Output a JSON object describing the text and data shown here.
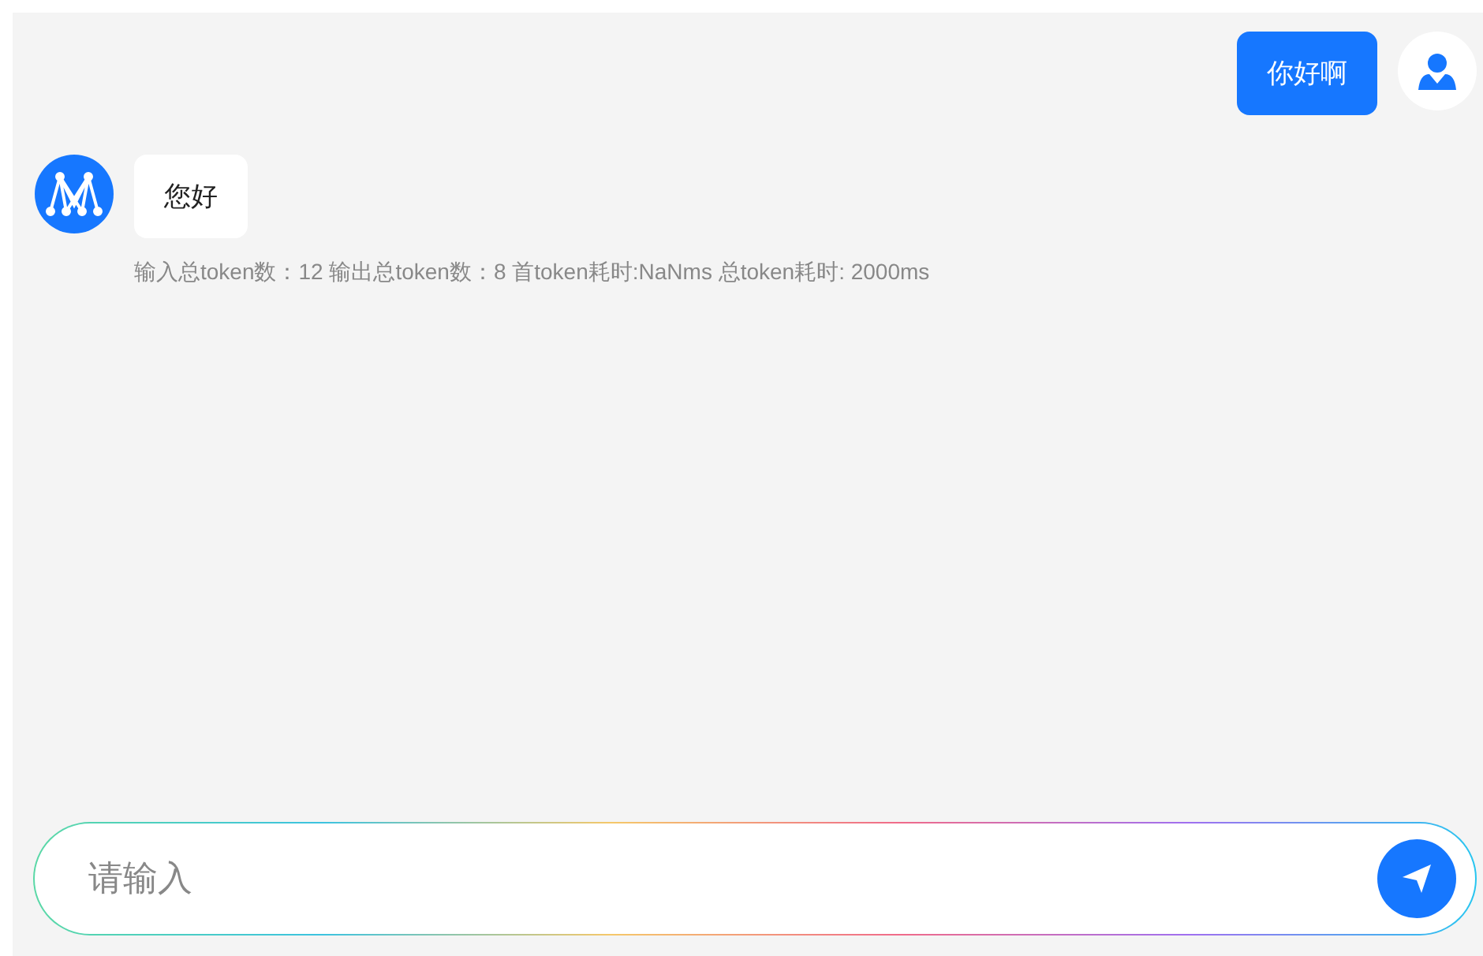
{
  "messages": [
    {
      "kind": "user",
      "text": "你好啊"
    },
    {
      "kind": "bot",
      "text": "您好",
      "stats": "输入总token数：12 输出总token数：8 首token耗时:NaNms 总token耗时: 2000ms"
    }
  ],
  "input": {
    "placeholder": "请输入"
  }
}
